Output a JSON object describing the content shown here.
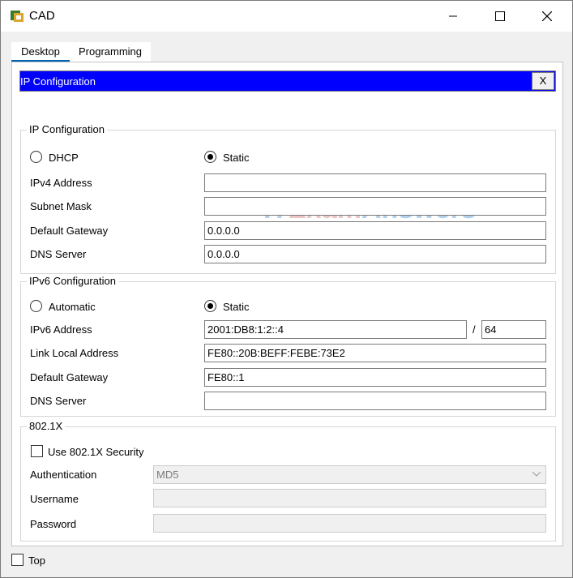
{
  "window": {
    "title": "CAD"
  },
  "tabs": {
    "desktop": "Desktop",
    "programming": "Programming"
  },
  "ip_config": {
    "bar_title": "IP Configuration",
    "close_label": "X",
    "ipv4": {
      "group_title": "IP Configuration",
      "dhcp_label": "DHCP",
      "static_label": "Static",
      "mode": "Static",
      "ipv4_address_label": "IPv4 Address",
      "ipv4_address_value": "",
      "subnet_mask_label": "Subnet Mask",
      "subnet_mask_value": "",
      "default_gateway_label": "Default Gateway",
      "default_gateway_value": "0.0.0.0",
      "dns_server_label": "DNS Server",
      "dns_server_value": "0.0.0.0"
    },
    "ipv6": {
      "group_title": "IPv6 Configuration",
      "automatic_label": "Automatic",
      "static_label": "Static",
      "mode": "Static",
      "ipv6_address_label": "IPv6 Address",
      "ipv6_address_value": "2001:DB8:1:2::4",
      "prefix_separator": "/",
      "prefix_value": "64",
      "link_local_label": "Link Local Address",
      "link_local_value": "FE80::20B:BEFF:FEBE:73E2",
      "default_gateway_label": "Default Gateway",
      "default_gateway_value": "FE80::1",
      "dns_server_label": "DNS Server",
      "dns_server_value": ""
    },
    "dot1x": {
      "group_title": "802.1X",
      "use_security_label": "Use 802.1X Security",
      "use_security_checked": false,
      "authentication_label": "Authentication",
      "authentication_value": "MD5",
      "username_label": "Username",
      "username_value": "",
      "password_label": "Password",
      "password_value": ""
    }
  },
  "footer": {
    "top_label": "Top",
    "top_checked": false
  },
  "watermark": {
    "part1": "IT",
    "part2": "Exam",
    "part3": "Answers"
  },
  "colors": {
    "title_bar_blue": "#0000ff",
    "tab_accent": "#0063b1"
  }
}
